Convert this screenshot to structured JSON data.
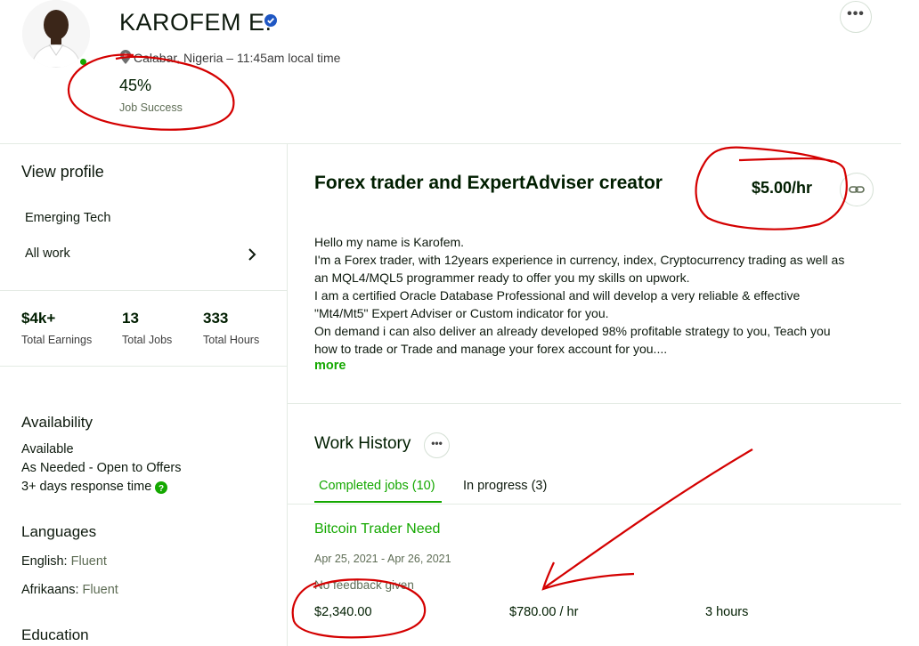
{
  "header": {
    "name": "KAROFEM E.",
    "location": "Calabar, Nigeria",
    "local_time": "– 11:45am local time",
    "job_success_value": "45%",
    "job_success_label": "Job Success",
    "more_label": "•••"
  },
  "sidebar": {
    "view_profile": "View profile",
    "items": [
      {
        "label": "Emerging Tech"
      },
      {
        "label": "All work"
      }
    ],
    "stats": [
      {
        "value": "$4k+",
        "label": "Total Earnings"
      },
      {
        "value": "13",
        "label": "Total Jobs"
      },
      {
        "value": "333",
        "label": "Total Hours"
      }
    ],
    "availability": {
      "heading": "Availability",
      "status": "Available",
      "mode": "As Needed - Open to Offers",
      "response": "3+ days response time"
    },
    "languages": {
      "heading": "Languages",
      "items": [
        {
          "name": "English:",
          "level": "Fluent"
        },
        {
          "name": "Afrikaans:",
          "level": "Fluent"
        }
      ]
    },
    "education": {
      "heading": "Education"
    }
  },
  "main": {
    "title": "Forex trader and ExpertAdviser creator",
    "rate": "$5.00/hr",
    "description": [
      "Hello my name is Karofem.",
      "I'm a Forex trader, with 12years experience in currency, index, Cryptocurrency trading as well as",
      "an MQL4/MQL5 programmer ready to offer you my skills on upwork.",
      "I am a certified Oracle Database Professional and will develop a very reliable & effective",
      "\"Mt4/Mt5\" Expert Adviser or Custom indicator for you.",
      "On demand i can also deliver an already developed 98% profitable strategy to you, Teach you",
      "how to trade or Trade and manage your forex account for you...."
    ],
    "more_link": "more"
  },
  "work_history": {
    "title": "Work History",
    "more_label": "•••",
    "tabs": [
      {
        "label": "Completed jobs (10)",
        "active": true
      },
      {
        "label": "In progress (3)",
        "active": false
      }
    ],
    "jobs": [
      {
        "title": "Bitcoin Trader Need",
        "dates": "Apr 25, 2021 - Apr 26, 2021",
        "feedback": "No feedback given",
        "amount": "$2,340.00",
        "rate": "$780.00 / hr",
        "hours": "3 hours"
      }
    ]
  },
  "colors": {
    "accent_green": "#14a800",
    "annotation_red": "#d40000",
    "verified_blue": "#1f57c3"
  },
  "icons": {
    "verified": "verified-badge-icon",
    "location": "location-pin-icon",
    "chevron": "chevron-right-icon",
    "link": "link-icon",
    "help": "help-circle-icon"
  }
}
